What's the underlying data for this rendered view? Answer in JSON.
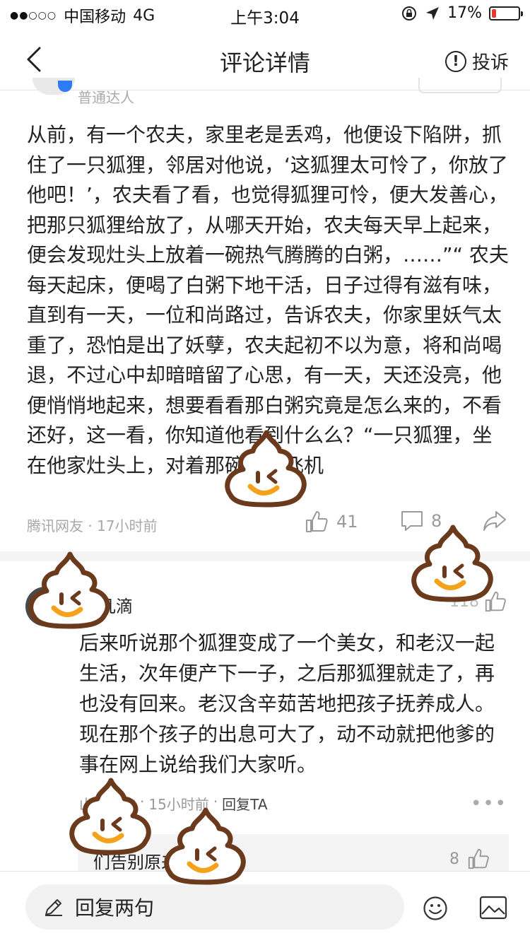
{
  "status_bar": {
    "signal": "●●○○○",
    "carrier": "中国移动",
    "network": "4G",
    "time": "上午3:04",
    "battery_percent": "17%",
    "battery_level": 0.17
  },
  "nav": {
    "title": "评论详情",
    "report_label": "投诉"
  },
  "partial_user": {
    "level": "普通达人"
  },
  "main_comment": {
    "text": "从前，有一个农夫，家里老是丢鸡，他便设下陷阱，抓住了一只狐狸，邻居对他说，‘这狐狸太可怜了，你放了他吧！’，农夫看了看，也觉得狐狸可怜，便大发善心，把那只狐狸给放了，从哪天开始，农夫每天早上起来，便会发现灶头上放着一碗热气腾腾的白粥，……”“ 农夫每天起床，便喝了白粥下地干活，日子过得有滋有味，直到有一天，一位和尚路过，告诉农夫，你家里妖气太重了，恐怕是出了妖孽，农夫起初不以为意，将和尚喝退，不过心中却暗暗留了心思，有一天，天还没亮，他便悄悄地起来，想要看看那白粥究竟是怎么来的，不看还好，这一看，你知道他看到什么么？“一只狐狸，坐在他家灶头上，对着那碗口打飞机",
    "meta": "腾讯网友 · 17小时前",
    "like_count": "41",
    "comment_count": "8"
  },
  "reply": {
    "author": "几滴",
    "like_count": "118",
    "text": "后来听说那个狐狸变成了一个美女，和老汉一起生活，次年便产下一子，之后那狐狸就走了，再也没有回来。老汉含辛茹苦地把孩子抚养成人。现在那个孩子的出息可大了，动不动就把他爹的事在网上说给我们大家听。",
    "source": "山东网友",
    "time": "15小时前",
    "reply_label": "回复TA",
    "sub_reply_text": "们告别原来是自己",
    "sub_like_count": "8"
  },
  "bottom_bar": {
    "input_label": "回复两句"
  },
  "colors": {
    "accent_blue": "#2d7cf6",
    "battery_red": "#e23b2e",
    "sticker_brown": "#6b3a1c",
    "sticker_fill": "#ffffff",
    "sticker_smile": "#f4a21b"
  }
}
